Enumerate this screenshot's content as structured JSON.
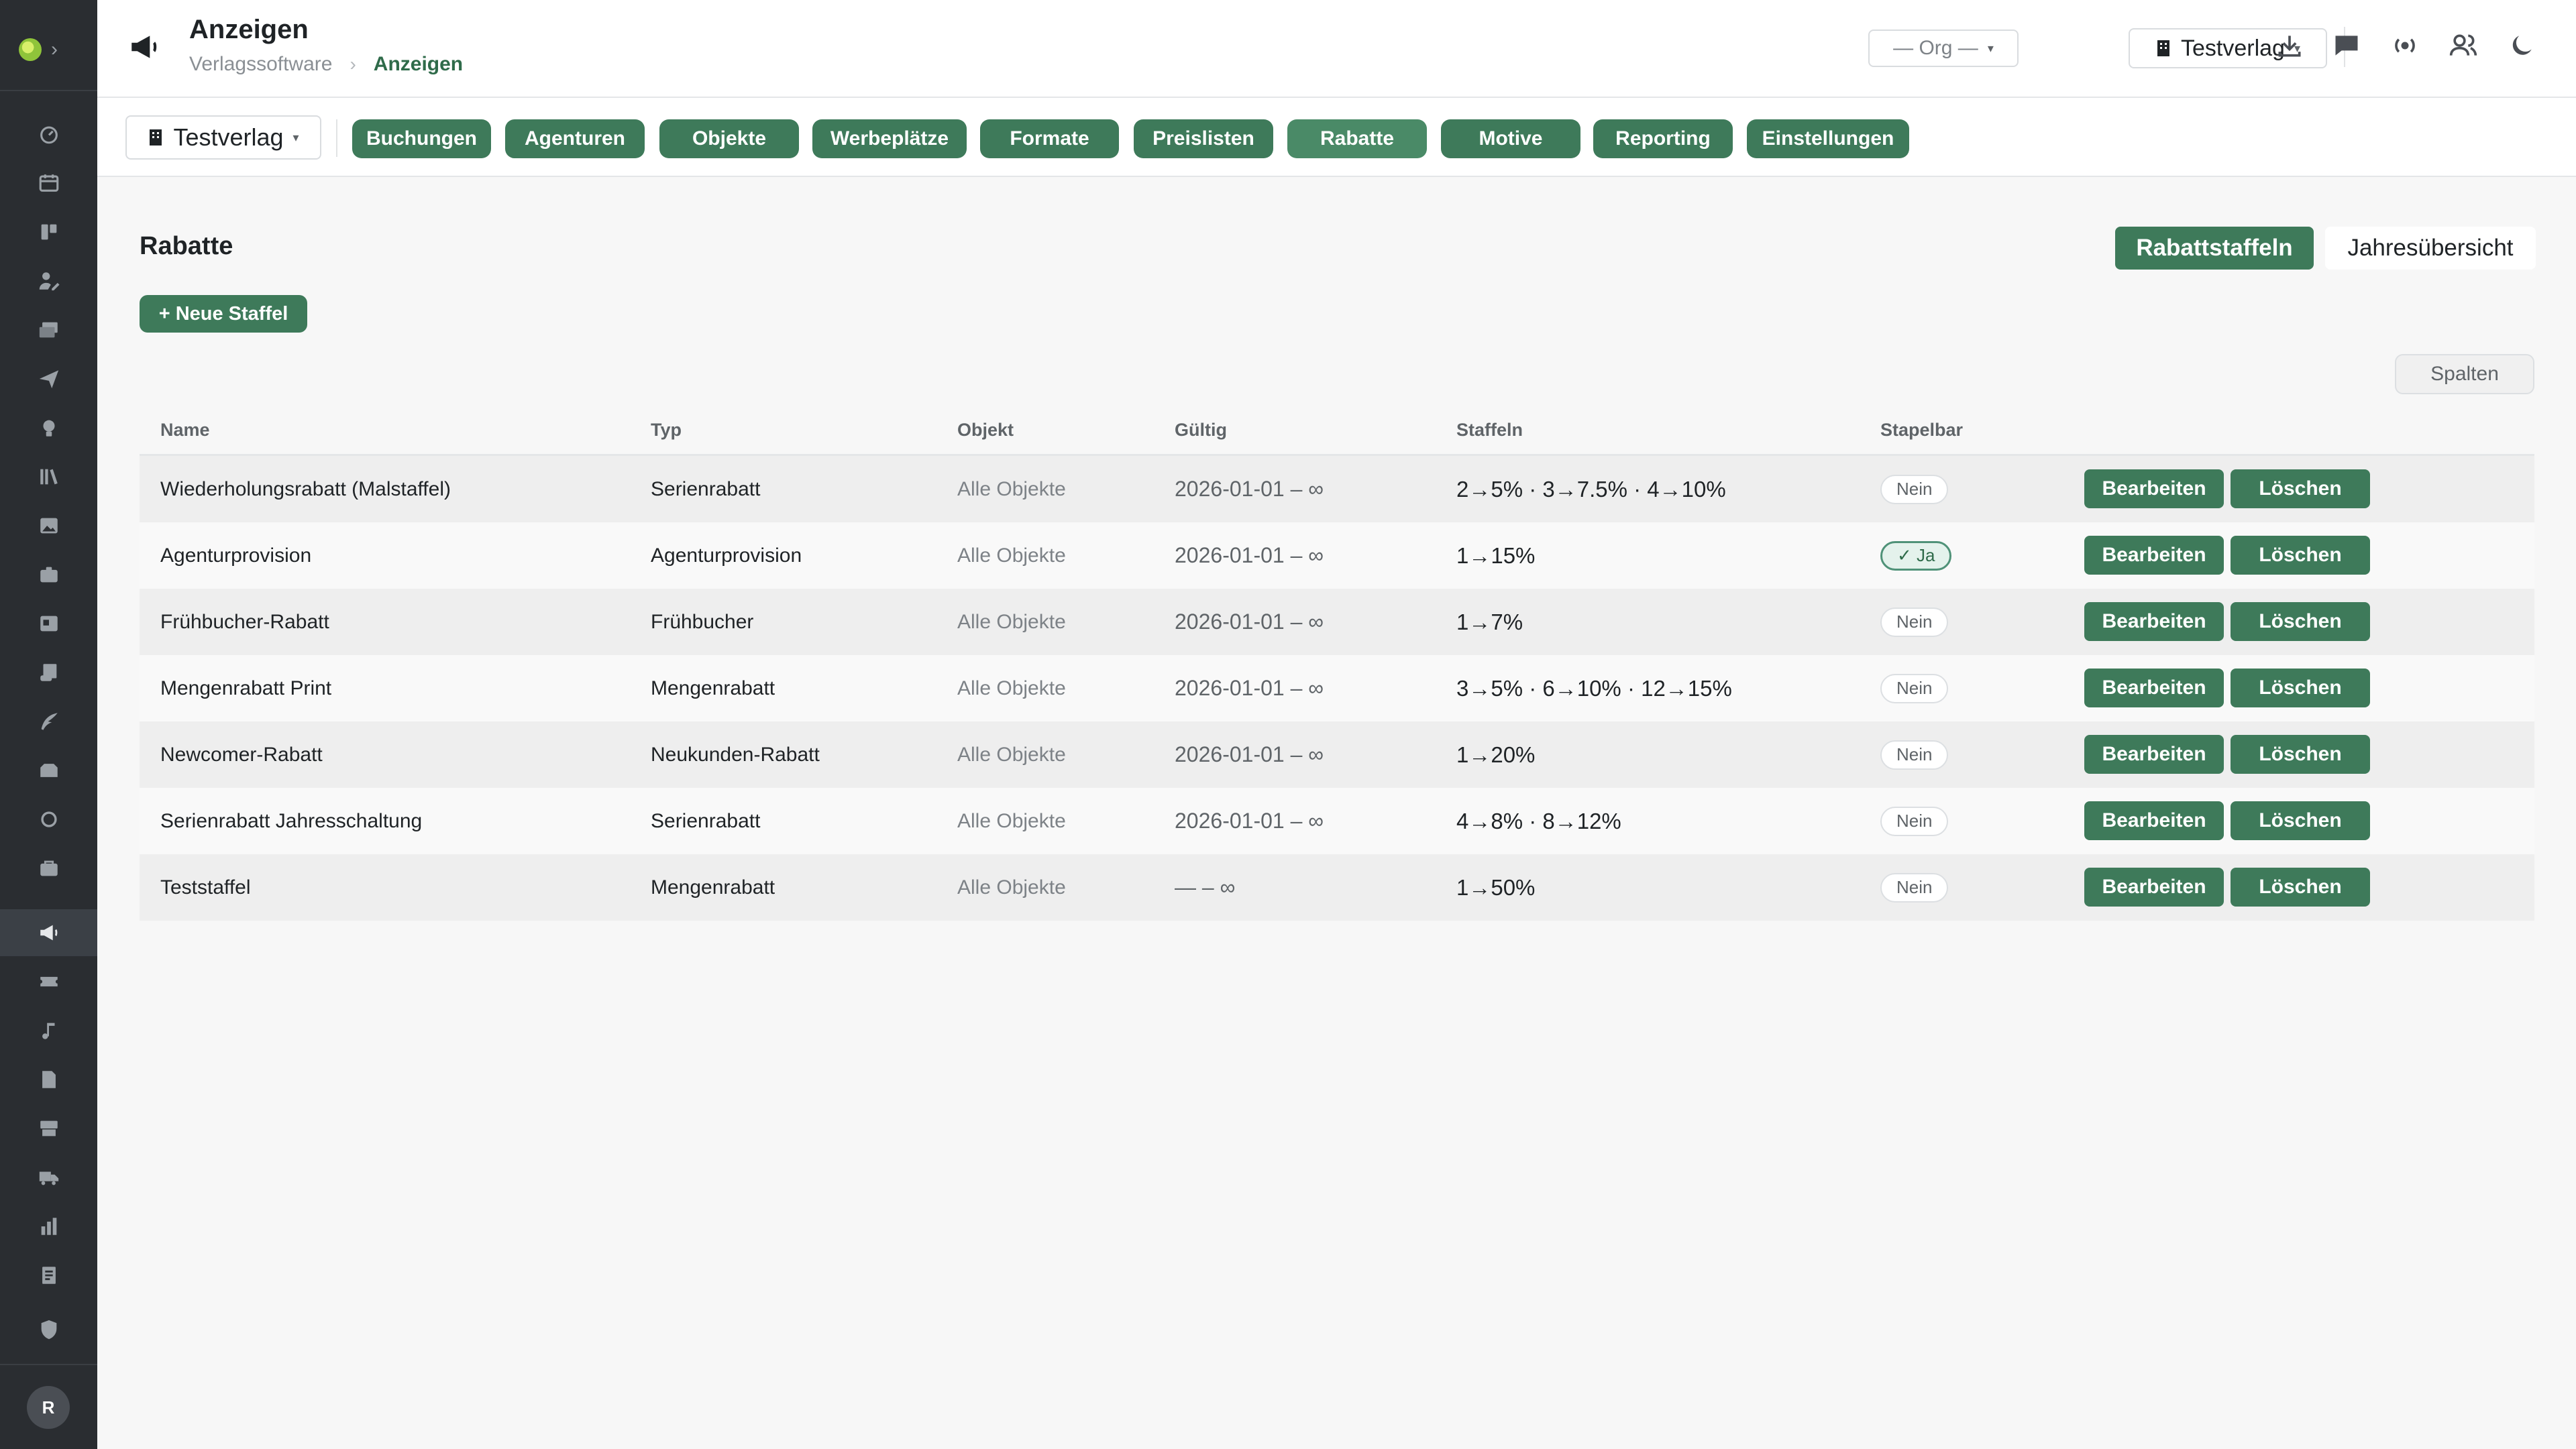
{
  "header": {
    "title": "Anzeigen",
    "breadcrumb": {
      "root": "Verlagssoftware",
      "separator": "›",
      "current": "Anzeigen"
    },
    "org_select": {
      "value": "— Org —",
      "caret": "▾"
    },
    "publisher_select": {
      "value": "Testverlag",
      "caret": "▾"
    },
    "icons": [
      "download-icon",
      "chat-icon",
      "broadcast-icon",
      "users-icon",
      "moon-icon"
    ]
  },
  "module_nav": {
    "context_select": {
      "value": "Testverlag",
      "caret": "▾"
    },
    "items": [
      {
        "label": "Buchungen"
      },
      {
        "label": "Agenturen"
      },
      {
        "label": "Objekte"
      },
      {
        "label": "Werbeplätze"
      },
      {
        "label": "Formate"
      },
      {
        "label": "Preislisten"
      },
      {
        "label": "Rabatte"
      },
      {
        "label": "Motive"
      },
      {
        "label": "Reporting"
      },
      {
        "label": "Einstellungen"
      }
    ],
    "active": "Rabatte"
  },
  "content": {
    "title": "Rabatte",
    "new_button": "+ Neue Staffel",
    "view_toggle": {
      "active": "Rabattstaffeln",
      "inactive": "Jahresübersicht"
    },
    "columns_button": "Spalten",
    "table": {
      "headers": {
        "name": "Name",
        "typ": "Typ",
        "objekt": "Objekt",
        "gueltig": "Gültig",
        "staffeln": "Staffeln",
        "stapelbar": "Stapelbar"
      },
      "edit_label": "Bearbeiten",
      "delete_label": "Löschen",
      "rows": [
        {
          "name": "Wiederholungsrabatt (Malstaffel)",
          "typ": "Serienrabatt",
          "objekt": "Alle Objekte",
          "gueltig": "2026-01-01 – ∞",
          "staffeln": "2→5% · 3→7.5% · 4→10%",
          "stapelbar": "Nein"
        },
        {
          "name": "Agenturprovision",
          "typ": "Agenturprovision",
          "objekt": "Alle Objekte",
          "gueltig": "2026-01-01 – ∞",
          "staffeln": "1→15%",
          "stapelbar": "✓ Ja"
        },
        {
          "name": "Frühbucher-Rabatt",
          "typ": "Frühbucher",
          "objekt": "Alle Objekte",
          "gueltig": "2026-01-01 – ∞",
          "staffeln": "1→7%",
          "stapelbar": "Nein"
        },
        {
          "name": "Mengenrabatt Print",
          "typ": "Mengenrabatt",
          "objekt": "Alle Objekte",
          "gueltig": "2026-01-01 – ∞",
          "staffeln": "3→5% · 6→10% · 12→15%",
          "stapelbar": "Nein"
        },
        {
          "name": "Newcomer-Rabatt",
          "typ": "Neukunden-Rabatt",
          "objekt": "Alle Objekte",
          "gueltig": "2026-01-01 – ∞",
          "staffeln": "1→20%",
          "stapelbar": "Nein"
        },
        {
          "name": "Serienrabatt Jahresschaltung",
          "typ": "Serienrabatt",
          "objekt": "Alle Objekte",
          "gueltig": "2026-01-01 – ∞",
          "staffeln": "4→8% · 8→12%",
          "stapelbar": "Nein"
        },
        {
          "name": "Teststaffel",
          "typ": "Mengenrabatt",
          "objekt": "Alle Objekte",
          "gueltig": "— – ∞",
          "staffeln": "1→50%",
          "stapelbar": "Nein"
        }
      ]
    }
  },
  "sidebar": {
    "avatar_initial": "R",
    "icons": [
      "dashboard-icon",
      "calendar-icon",
      "kanban-icon",
      "user-edit-icon",
      "mail-stack-icon",
      "send-icon",
      "idea-icon",
      "library-icon",
      "image-icon",
      "briefcase-icon",
      "id-card-icon",
      "scroll-icon",
      "quill-icon",
      "inbox-icon",
      "circle-icon",
      "bag-icon",
      "megaphone-icon",
      "ticket-icon",
      "music-icon",
      "document-icon",
      "store-icon",
      "truck-icon",
      "bar-chart-icon",
      "clipboard-icon",
      "shield-icon"
    ],
    "active_icon": "megaphone-icon"
  },
  "colors": {
    "accent": "#3e7a5a",
    "rail": "#2a2d31",
    "breadcrumb_current": "#2f6b4a"
  }
}
